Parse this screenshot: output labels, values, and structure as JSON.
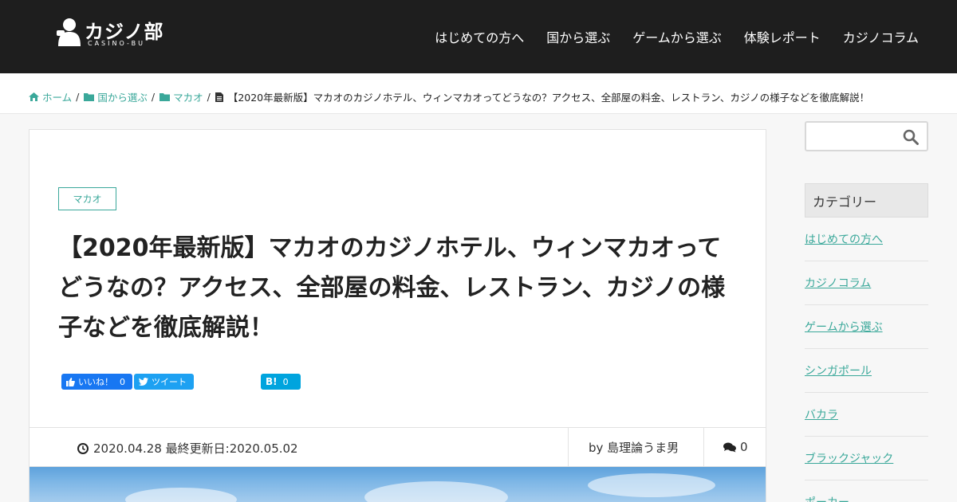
{
  "header": {
    "logo_text": "カジノ部",
    "logo_sub": "CASINO-BU",
    "nav": [
      "はじめての方へ",
      "国から選ぶ",
      "ゲームから選ぶ",
      "体験レポート",
      "カジノコラム"
    ]
  },
  "breadcrumb": {
    "home": "ホーム",
    "level1": "国から選ぶ",
    "level2": "マカオ",
    "current": "【2020年最新版】マカオのカジノホテル、ウィンマカオってどうなの？アクセス、全部屋の料金、レストラン、カジノの様子などを徹底解説！"
  },
  "article": {
    "category": "マカオ",
    "title": "【2020年最新版】マカオのカジノホテル、ウィンマカオってどうなの？アクセス、全部屋の料金、レストラン、カジノの様子などを徹底解説！",
    "share": {
      "fb_label": "いいね！",
      "fb_count": "0",
      "tw_label": "ツイート",
      "hb_label": "B!",
      "hb_count": "0"
    },
    "meta": {
      "date": "2020.04.28 最終更新日:2020.05.02",
      "author": "by 島理論うま男",
      "comments": "0"
    }
  },
  "sidebar": {
    "search_placeholder": "",
    "category_heading": "カテゴリー",
    "categories": [
      "はじめての方へ",
      "カジノコラム",
      "ゲームから選ぶ",
      "シンガポール",
      "バカラ",
      "ブラックジャック",
      "ポーカー"
    ]
  },
  "colors": {
    "accent": "#3aa89a",
    "header_bg": "#1e1e1e",
    "facebook": "#1877f2",
    "twitter": "#1da1f2",
    "hatena": "#00a4de"
  }
}
